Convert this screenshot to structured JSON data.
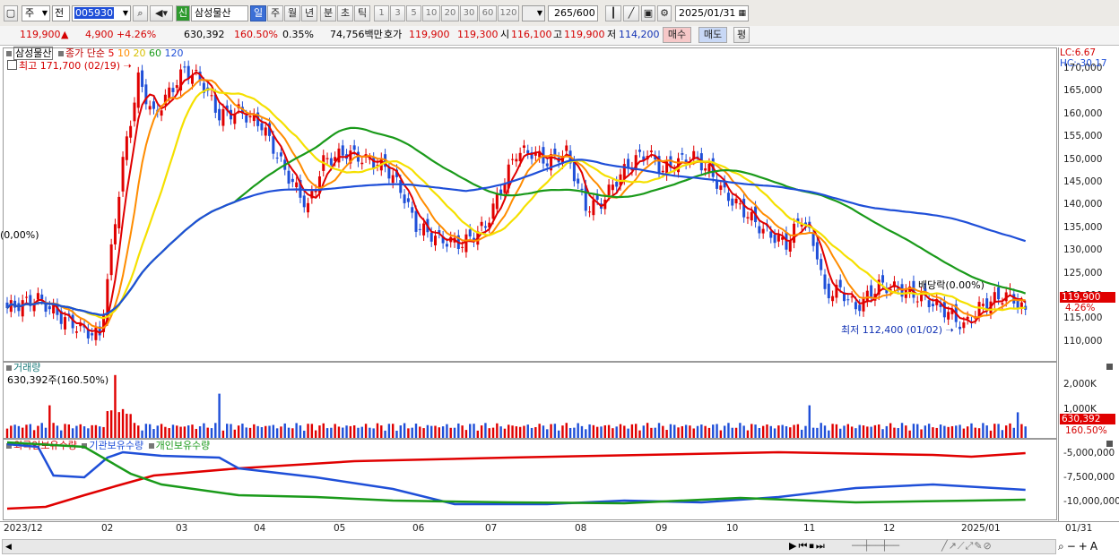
{
  "toolbar": {
    "type_select": "주",
    "market_select": "전",
    "code": "005930",
    "credit_badge": "신",
    "stock_name": "삼성물산",
    "periods": [
      "일",
      "주",
      "월",
      "년",
      "분",
      "초",
      "틱"
    ],
    "numbers": [
      "1",
      "3",
      "5",
      "10",
      "20",
      "30",
      "60",
      "120"
    ],
    "count": "265",
    "count_total": "/600",
    "date": "2025/01/31"
  },
  "quote": {
    "price": "119,900",
    "change_arrow": "▲",
    "change": "4,900",
    "change_pct": "+4.26%",
    "volume": "630,392",
    "volume_ratio": "160.50%",
    "turnover": "0.35%",
    "amount": "74,756백만",
    "bid_label": "호가",
    "bid1": "119,900",
    "bid2": "119,300",
    "open_label": "시",
    "open": "116,100",
    "high_label": "고",
    "high": "119,900",
    "low_label": "저",
    "low": "114,200",
    "buy": "매수",
    "sell": "매도",
    "eval": "평"
  },
  "price_pane": {
    "title": "삼성물산",
    "ma_label": "종가 단순",
    "ma_periods": [
      "5",
      "10",
      "20",
      "60",
      "120"
    ],
    "ma_colors": [
      "#e00000",
      "#ff8c00",
      "#f5e000",
      "#1a9a1a",
      "#1f4fd8"
    ],
    "high_marker": "최고 171,700 (02/19)",
    "low_marker": "최저 112,400 (01/02)",
    "start_marker": "(0,00%)",
    "dividend_marker": "배당락(0.00%)",
    "lc": "LC:6.67",
    "hc": "HC:-30.17",
    "last_price": "119,900",
    "last_pct": "4.26%",
    "y_labels": [
      "170,000",
      "165,000",
      "160,000",
      "155,000",
      "150,000",
      "145,000",
      "140,000",
      "135,000",
      "130,000",
      "125,000",
      "120,000",
      "115,000",
      "110,000"
    ]
  },
  "volume_pane": {
    "title": "거래량",
    "value": "630,392주(160.50%)",
    "y_labels": [
      "2,000K",
      "1,000K"
    ],
    "last_volume": "630,392",
    "last_pct": "160.50%"
  },
  "holder_pane": {
    "legend": [
      "외국인보유수량",
      "기관보유수량",
      "개인보유수량"
    ],
    "colors": [
      "#e00000",
      "#1f4fd8",
      "#1a9a1a"
    ],
    "y_labels": [
      "-5,000,000",
      "-7,500,000",
      "-10,000,000"
    ]
  },
  "x_axis": {
    "labels": [
      "2023/12",
      "02",
      "03",
      "04",
      "05",
      "06",
      "07",
      "08",
      "09",
      "10",
      "11",
      "12",
      "2025/01",
      "01/31"
    ]
  },
  "colors": {
    "up": "#e00000",
    "down": "#1f4fd8",
    "accent": "#3b6fd6"
  }
}
